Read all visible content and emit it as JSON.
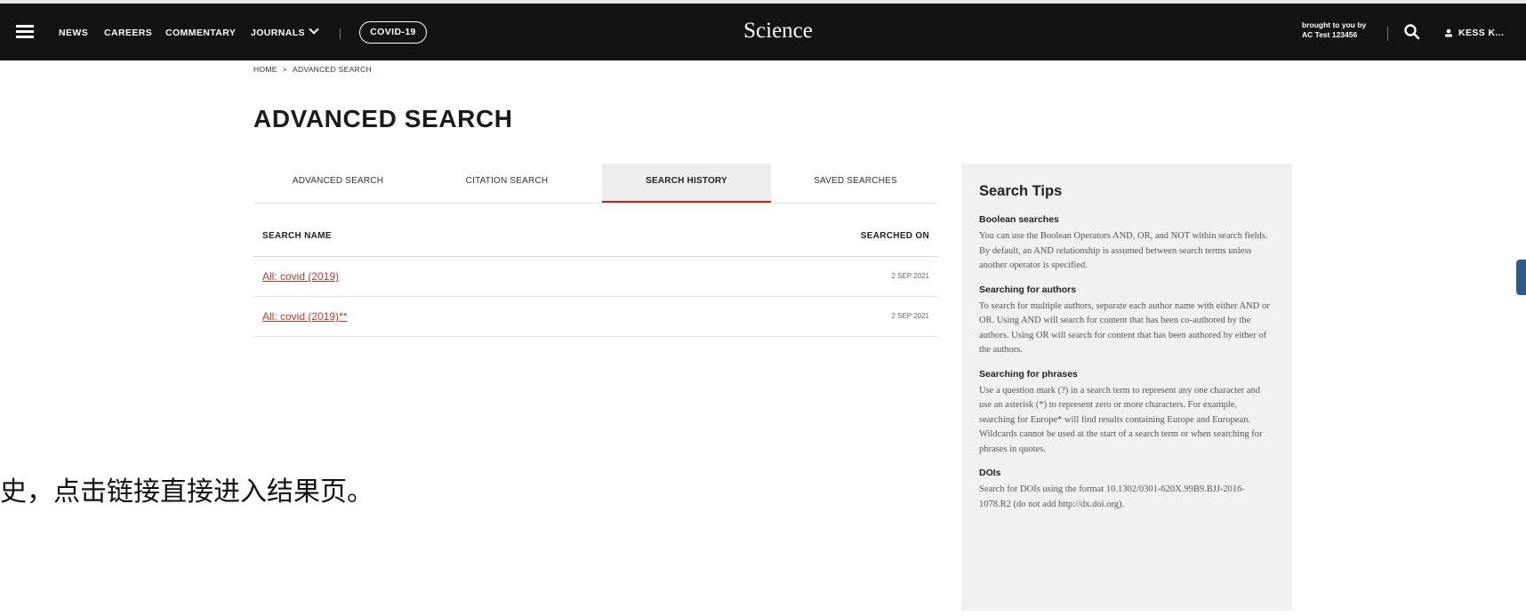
{
  "header": {
    "nav": {
      "news": "NEWS",
      "careers": "CAREERS",
      "commentary": "COMMENTARY",
      "journals": "JOURNALS",
      "covid": "COVID-19"
    },
    "logo": "Science",
    "brought_by_line1": "brought to you by",
    "brought_by_line2": "AC Test 123456",
    "user_label": "KESS K..."
  },
  "breadcrumb": {
    "home": "HOME",
    "separator": ">",
    "current": "ADVANCED SEARCH"
  },
  "page_title": "ADVANCED SEARCH",
  "tabs": {
    "advanced": "ADVANCED SEARCH",
    "citation": "CITATION SEARCH",
    "history": "SEARCH HISTORY",
    "saved": "SAVED SEARCHES",
    "active": "history"
  },
  "history": {
    "col_name": "SEARCH NAME",
    "col_date": "SEARCHED ON",
    "rows": [
      {
        "name": "All: covid (2019)",
        "date": "2 SEP 2021"
      },
      {
        "name": "All: covid (2019)**",
        "date": "2 SEP 2021"
      }
    ]
  },
  "tips": {
    "title": "Search Tips",
    "sections": [
      {
        "heading": "Boolean searches",
        "body": "You can use the Boolean Operators AND, OR, and NOT within search fields. By default, an AND relationship is assumed between search terms unless another operator is specified."
      },
      {
        "heading": "Searching for authors",
        "body": "To search for multiple authors, separate each author name with either AND or OR. Using AND will search for content that has been co-authored by the authors. Using OR will search for content that has been authored by either of the authors."
      },
      {
        "heading": "Searching for phrases",
        "body": "Use a question mark (?) in a search term to represent any one character and use an asterisk (*) to represent zero or more characters. For example, searching for Europe* will find results containing Europe and European. Wildcards cannot be used at the start of a search term or when searching for phrases in quotes."
      },
      {
        "heading": "DOIs",
        "body": "Search for DOIs using the format 10.1302/0301-620X.99B9.BJJ-2016-1078.R2 (do not add http://dx.doi.org)."
      }
    ]
  },
  "overlay_annotation": "史，点击链接直接进入结果页。",
  "colors": {
    "header_bg": "#131313",
    "link_red": "#c0392b",
    "active_tab_underline": "#b3261e",
    "tips_bg": "#f1f1f1"
  }
}
